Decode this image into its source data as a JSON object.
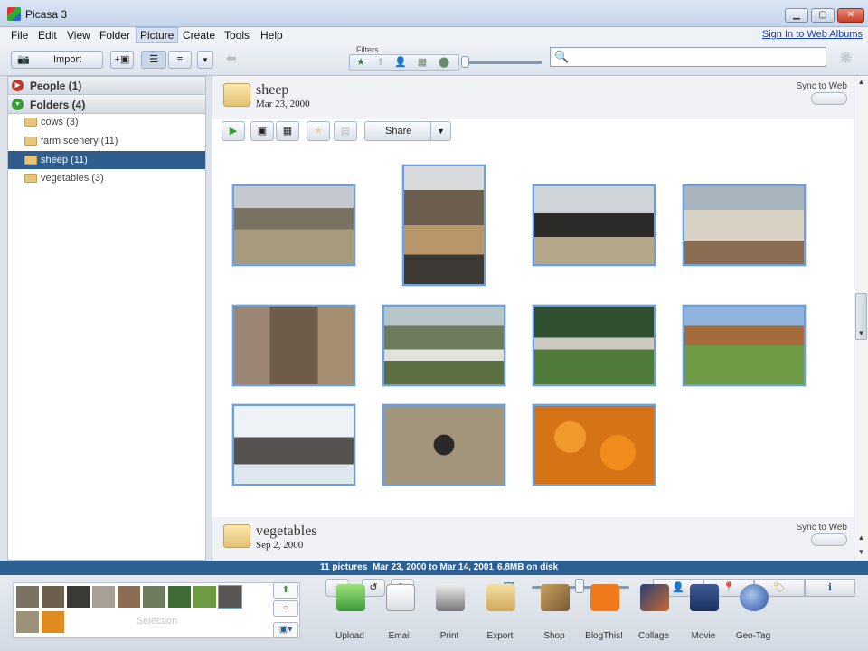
{
  "window": {
    "title": "Picasa 3"
  },
  "menu": [
    "File",
    "Edit",
    "View",
    "Folder",
    "Picture",
    "Create",
    "Tools",
    "Help"
  ],
  "signin_link": "Sign In to Web Albums",
  "toolbar": {
    "import_label": "Import",
    "filters_label": "Filters"
  },
  "left_panel": {
    "people_label": "People (1)",
    "folders_label": "Folders (4)",
    "folders": [
      "cows (3)",
      "farm scenery (11)",
      "sheep (11)",
      "vegetables (3)"
    ],
    "selected_folder": "sheep (11)"
  },
  "albums": [
    {
      "name": "sheep",
      "date": "Mar 23, 2000",
      "sync_label": "Sync to Web"
    },
    {
      "name": "vegetables",
      "date": "Sep 2, 2000",
      "sync_label": "Sync to Web"
    }
  ],
  "album_toolbar": {
    "share_label": "Share"
  },
  "status": {
    "count": "11 pictures",
    "range": "Mar 23, 2000 to Mar 14, 2001",
    "size": "6.8MB on disk"
  },
  "tray": {
    "selection_label": "Selection"
  },
  "tools": [
    "Upload",
    "Email",
    "Print",
    "Export",
    "Shop",
    "BlogThis!",
    "Collage",
    "Movie",
    "Geo-Tag"
  ],
  "colors": {
    "selection": "#2f5d8e",
    "status_bar": "#2e5f93",
    "thumb_border": "#6aa1dc"
  }
}
